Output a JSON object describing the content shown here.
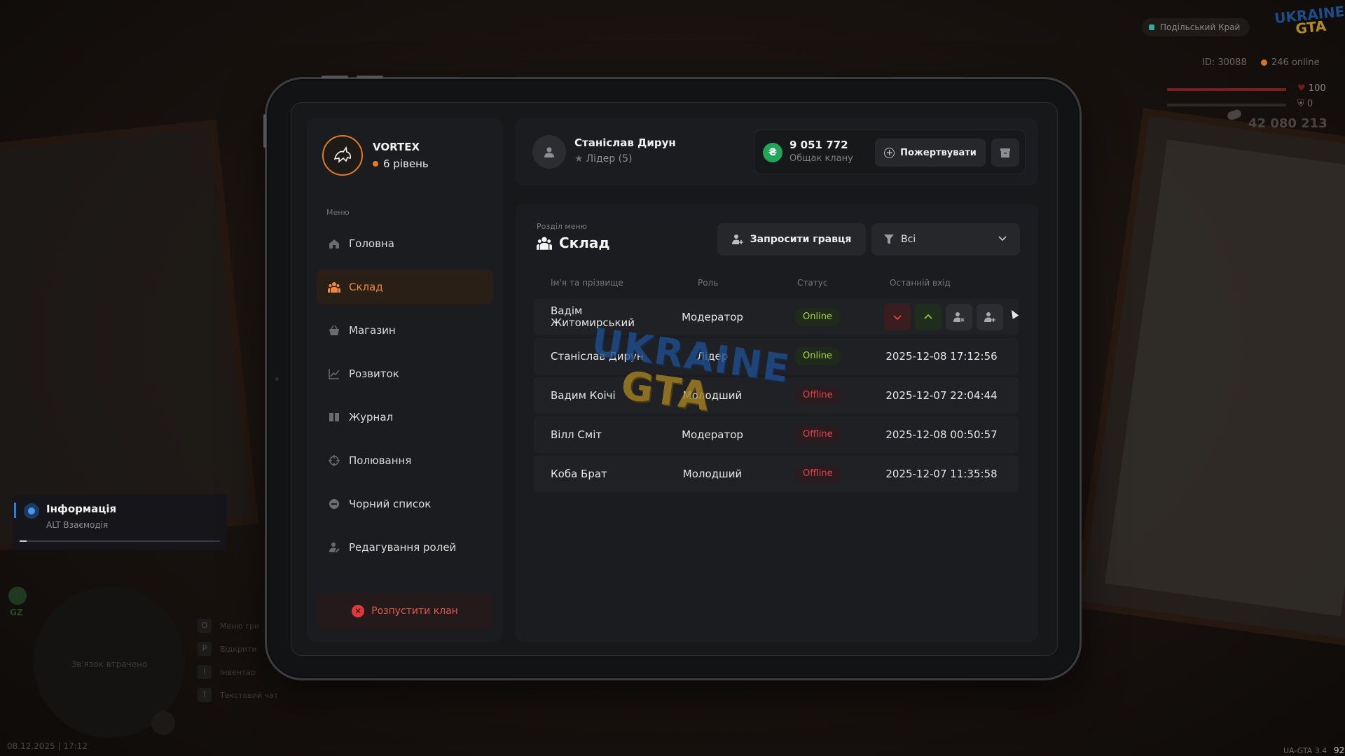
{
  "hud": {
    "server_name": "Подільський Край",
    "logo_top": "UKRAINE",
    "logo_bottom": "GTA",
    "player_id": "ID: 30088",
    "online": "246 online",
    "health": "100",
    "armor": "0",
    "money": "42 080 213",
    "hp_fraction": 1.0,
    "armor_fraction": 0.0
  },
  "notification": {
    "title": "Інформація",
    "subtitle": "ALT Взаємодія"
  },
  "minimap": {
    "lost_signal": "Зв'язок втрачено",
    "gz": "GZ"
  },
  "hotkeys": [
    {
      "key": "O",
      "label": "Меню гри"
    },
    {
      "key": "P",
      "label": "Відкрити"
    },
    {
      "key": "I",
      "label": "Інвентар"
    },
    {
      "key": "T",
      "label": "Текстовий чат"
    }
  ],
  "datetime": "08.12.2025 | 17:12",
  "version": "UA-GTA 3.4",
  "fps": "92",
  "sidebar": {
    "clan_name": "VORTEX",
    "clan_level": "6 рівень",
    "menu_caption": "Меню",
    "items": [
      {
        "label": "Головна",
        "icon": "home-icon"
      },
      {
        "label": "Склад",
        "icon": "users-icon"
      },
      {
        "label": "Магазин",
        "icon": "basket-icon"
      },
      {
        "label": "Розвиток",
        "icon": "chart-icon"
      },
      {
        "label": "Журнал",
        "icon": "book-icon"
      },
      {
        "label": "Полювання",
        "icon": "crosshair-icon"
      },
      {
        "label": "Чорний список",
        "icon": "blocked-icon"
      },
      {
        "label": "Редагування ролей",
        "icon": "user-edit-icon"
      }
    ],
    "disband_label": "Розпустити клан"
  },
  "header": {
    "user_name": "Станіслав Дирун",
    "user_role": "Лідер (5)",
    "bank_amount": "9 051 772",
    "bank_label": "Общак клану",
    "donate_label": "Пожертвувати"
  },
  "main": {
    "section_caption": "Розділ меню",
    "section_title": "Склад",
    "invite_label": "Запросити гравця",
    "filter_value": "Всі",
    "columns": [
      "Ім'я та прізвище",
      "Роль",
      "Статус",
      "Останній вхід"
    ],
    "members": [
      {
        "name": "Вадім Житомирський",
        "role": "Модератор",
        "status": "Online",
        "last_login": ""
      },
      {
        "name": "Станіслав Дирун",
        "role": "Лідер",
        "status": "Online",
        "last_login": "2025-12-08 17:12:56"
      },
      {
        "name": "Вадим Коічі",
        "role": "Молодший",
        "status": "Offline",
        "last_login": "2025-12-07 22:04:44"
      },
      {
        "name": "Вілл Сміт",
        "role": "Модератор",
        "status": "Offline",
        "last_login": "2025-12-08 00:50:57"
      },
      {
        "name": "Коба Брат",
        "role": "Молодший",
        "status": "Offline",
        "last_login": "2025-12-07 11:35:58"
      }
    ]
  },
  "watermark": {
    "top": "UKRAINE",
    "bottom": "GTA"
  },
  "colors": {
    "accent": "#f08a3a",
    "online": "#a9d24a",
    "offline": "#e0444a",
    "bank": "#22a55a"
  }
}
